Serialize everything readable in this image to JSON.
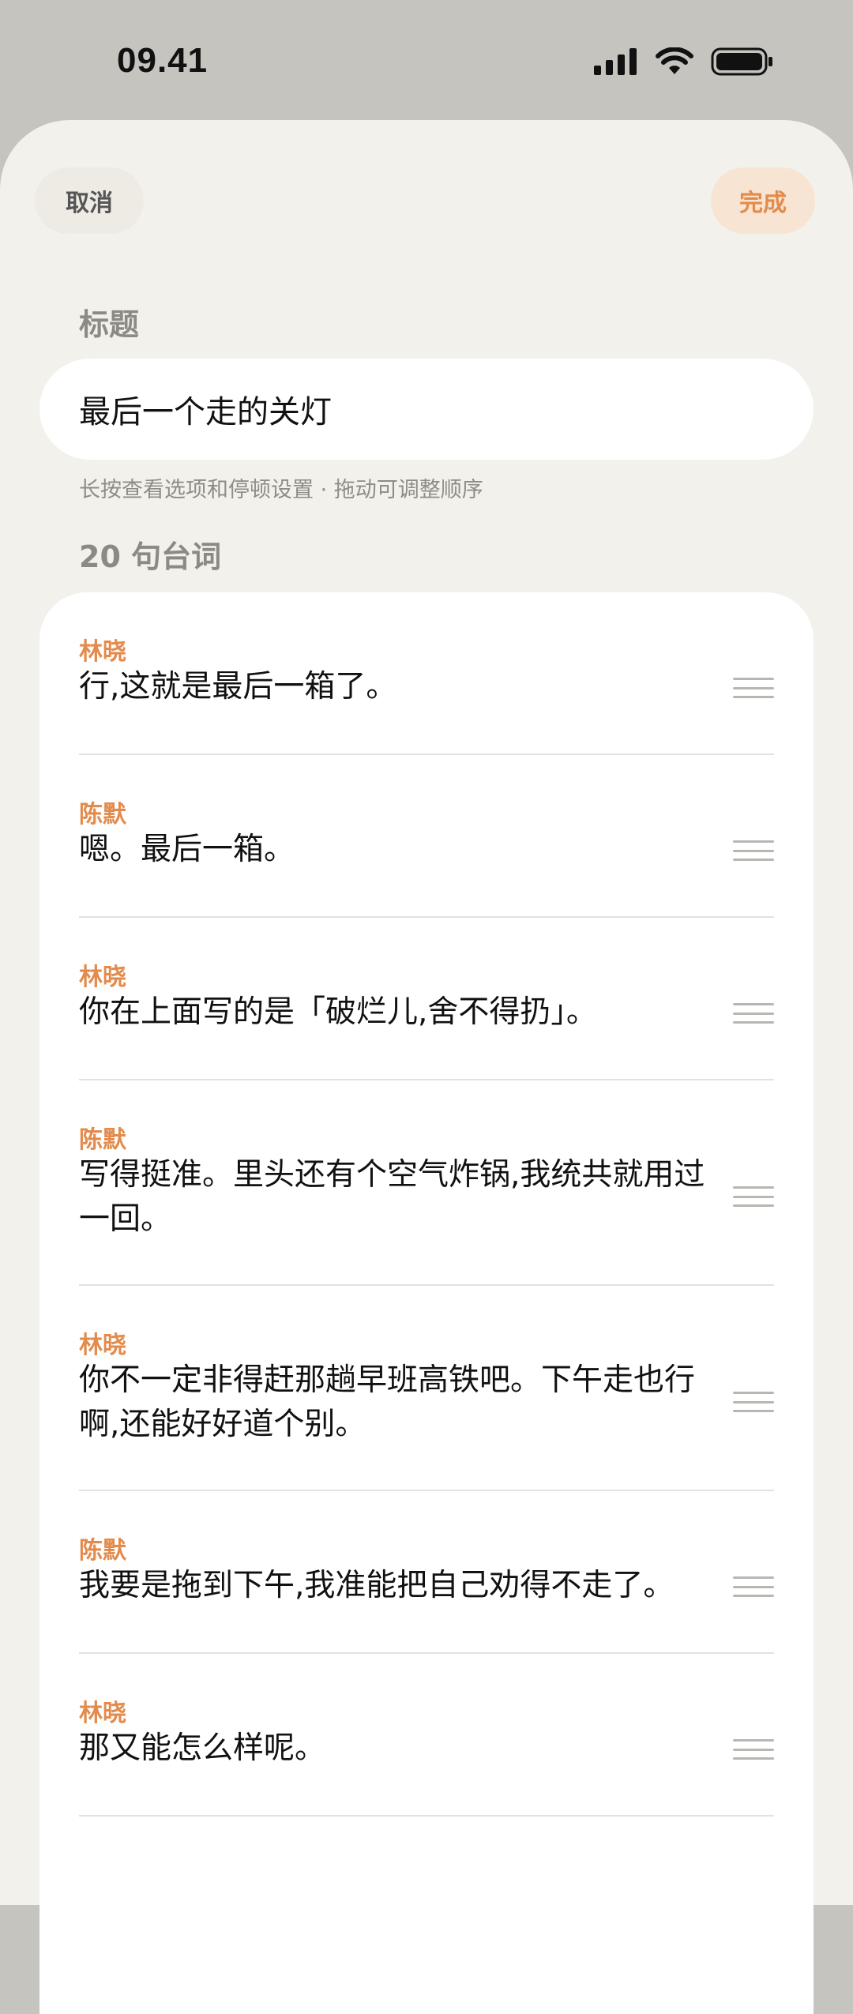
{
  "status_bar": {
    "time": "09.41"
  },
  "nav": {
    "cancel_label": "取消",
    "done_label": "完成"
  },
  "title_section": {
    "label": "标题",
    "value": "最后一个走的关灯",
    "hint": "长按查看选项和停顿设置 · 拖动可调整顺序"
  },
  "lines_section": {
    "label": "20 句台词",
    "items": [
      {
        "speaker": "林晓",
        "text": "行,这就是最后一箱了。"
      },
      {
        "speaker": "陈默",
        "text": "嗯。最后一箱。"
      },
      {
        "speaker": "林晓",
        "text": "你在上面写的是「破烂儿,舍不得扔」。"
      },
      {
        "speaker": "陈默",
        "text": "写得挺准。里头还有个空气炸锅,我统共就用过一回。"
      },
      {
        "speaker": "林晓",
        "text": "你不一定非得赶那趟早班高铁吧。下午走也行啊,还能好好道个别。"
      },
      {
        "speaker": "陈默",
        "text": "我要是拖到下午,我准能把自己劝得不走了。"
      },
      {
        "speaker": "林晓",
        "text": "那又能怎么样呢。"
      }
    ]
  },
  "colors": {
    "accent": "#e38b4d",
    "sheet_bg": "#f3f1ec",
    "status_bg": "#c5c4bf"
  }
}
